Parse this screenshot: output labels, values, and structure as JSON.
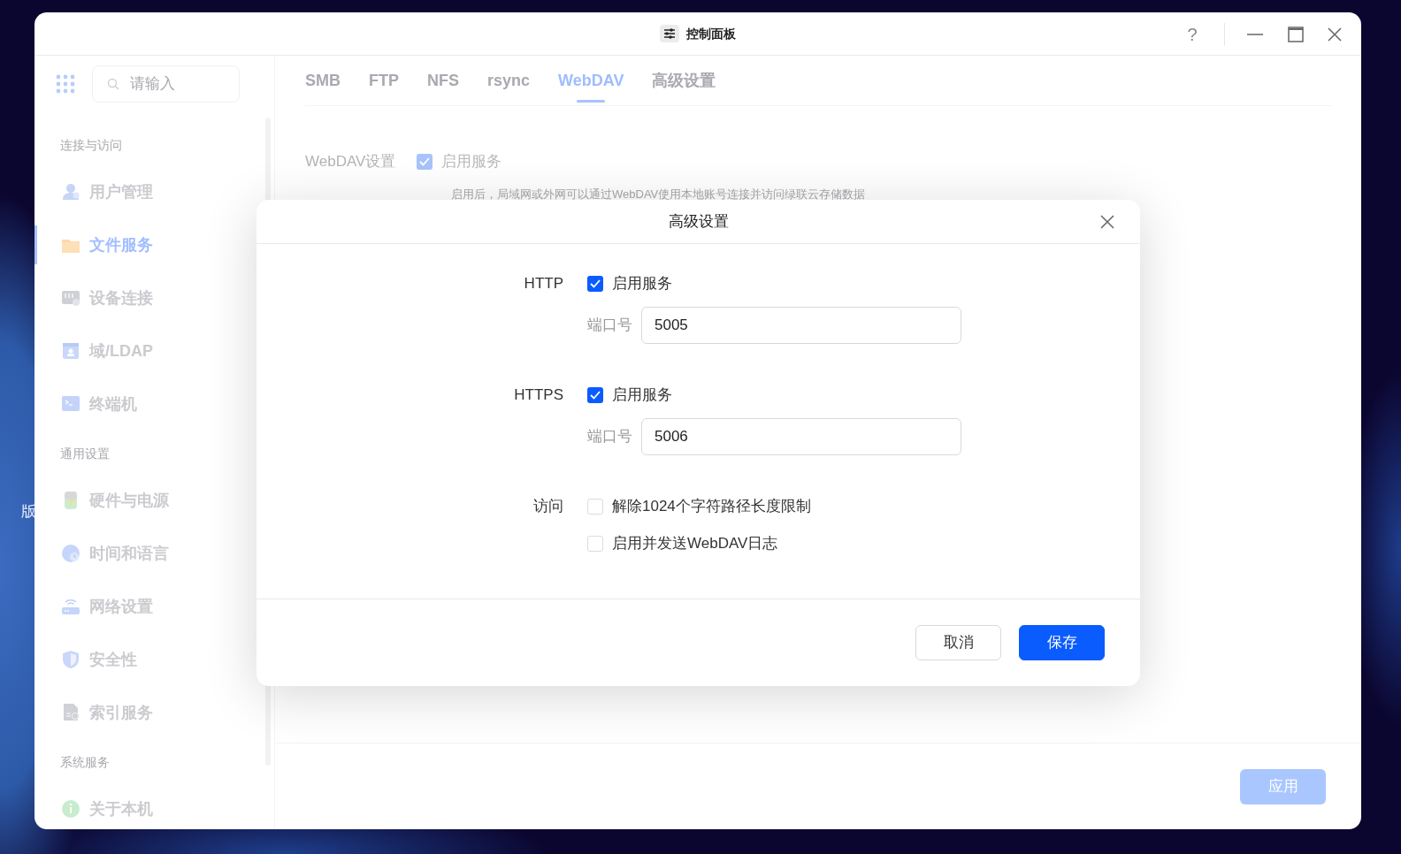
{
  "desktop": {
    "label": "版"
  },
  "window": {
    "title": "控制面板",
    "help_glyph": "?"
  },
  "sidebar": {
    "search": {
      "placeholder": "请输入"
    },
    "sections": [
      {
        "title": "连接与访问",
        "items": [
          {
            "label": "用户管理",
            "kind": "users",
            "selected": false
          },
          {
            "label": "文件服务",
            "kind": "folder",
            "selected": true
          },
          {
            "label": "设备连接",
            "kind": "device",
            "selected": false
          },
          {
            "label": "域/LDAP",
            "kind": "directory",
            "selected": false
          },
          {
            "label": "终端机",
            "kind": "terminal",
            "selected": false
          }
        ]
      },
      {
        "title": "通用设置",
        "items": [
          {
            "label": "硬件与电源",
            "kind": "battery",
            "selected": false
          },
          {
            "label": "时间和语言",
            "kind": "clock",
            "selected": false
          },
          {
            "label": "网络设置",
            "kind": "router",
            "selected": false
          },
          {
            "label": "安全性",
            "kind": "shield",
            "selected": false
          },
          {
            "label": "索引服务",
            "kind": "index",
            "selected": false
          }
        ]
      },
      {
        "title": "系统服务",
        "items": [
          {
            "label": "关于本机",
            "kind": "info",
            "selected": false
          }
        ]
      }
    ]
  },
  "tabs": [
    {
      "label": "SMB",
      "selected": false
    },
    {
      "label": "FTP",
      "selected": false
    },
    {
      "label": "NFS",
      "selected": false
    },
    {
      "label": "rsync",
      "selected": false
    },
    {
      "label": "WebDAV",
      "selected": true
    },
    {
      "label": "高级设置",
      "selected": false
    }
  ],
  "webdav": {
    "label": "WebDAV设置",
    "enable": {
      "label": "启用服务",
      "checked": true
    },
    "hint": "启用后，局域网或外网可以通过WebDAV使用本地账号连接并访问绿联云存储数据"
  },
  "apply_button": {
    "label": "应用",
    "disabled": true
  },
  "dialog": {
    "title": "高级设置",
    "sections": [
      {
        "label": "HTTP",
        "options": [
          {
            "label": "启用服务",
            "checked": true
          }
        ],
        "port": {
          "label": "端口号",
          "value": "5005"
        }
      },
      {
        "label": "HTTPS",
        "options": [
          {
            "label": "启用服务",
            "checked": true
          }
        ],
        "port": {
          "label": "端口号",
          "value": "5006"
        }
      },
      {
        "label": "访问",
        "options": [
          {
            "label": "解除1024个字符路径长度限制",
            "checked": false
          },
          {
            "label": "启用并发送WebDAV日志",
            "checked": false
          }
        ]
      }
    ],
    "buttons": [
      {
        "label": "取消",
        "kind": "secondary"
      },
      {
        "label": "保存",
        "kind": "primary"
      }
    ]
  }
}
